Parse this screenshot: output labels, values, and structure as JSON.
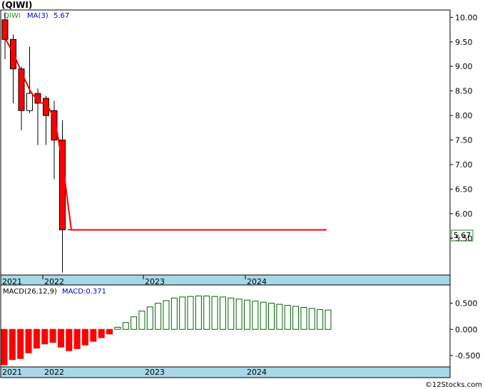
{
  "header": {
    "ticker": "(QIWI)",
    "series_label": "QIWI",
    "ma_label": "MA(3)",
    "ma_value": "5.67"
  },
  "price_badge": "5.67",
  "macd_label": "MACD(26,12,9)",
  "macd_value_label": "MACD:0.371",
  "watermark": "©12Stocks.com",
  "colors": {
    "down": "#ff0000",
    "up": "#ffffff",
    "ma": "#ff0000",
    "macd_pos": "#006400",
    "macd_neg": "#ff0000",
    "axis_band": "#a8d8e8"
  },
  "chart_data": [
    {
      "type": "candlestick",
      "title": "(QIWI)",
      "ma_label": "MA(3)",
      "x_labels": [
        "2021",
        "2022",
        "2023",
        "2024"
      ],
      "y_ticks": [
        5.5,
        6.0,
        6.5,
        7.0,
        7.5,
        8.0,
        8.5,
        9.0,
        9.5,
        10.0
      ],
      "y_tick_labels": [
        "5.50",
        "6.00",
        "6.50",
        "7.00",
        "7.50",
        "8.00",
        "8.50",
        "9.00",
        "9.50",
        "10.00"
      ],
      "ylim": [
        4.75,
        10.15
      ],
      "candles": [
        {
          "open": 9.95,
          "high": 10.1,
          "low": 9.15,
          "close": 9.55
        },
        {
          "open": 9.55,
          "high": 9.65,
          "low": 8.25,
          "close": 8.95
        },
        {
          "open": 8.95,
          "high": 9.0,
          "low": 7.7,
          "close": 8.1
        },
        {
          "open": 8.1,
          "high": 9.4,
          "low": 8.05,
          "close": 8.45
        },
        {
          "open": 8.45,
          "high": 8.55,
          "low": 7.4,
          "close": 8.25
        },
        {
          "open": 8.35,
          "high": 8.4,
          "low": 7.4,
          "close": 8.0
        },
        {
          "open": 8.1,
          "high": 8.3,
          "low": 6.7,
          "close": 7.5
        },
        {
          "open": 7.5,
          "high": 7.9,
          "low": 4.8,
          "close": 5.67
        },
        {
          "open": 5.67,
          "high": 5.67,
          "low": 5.67,
          "close": 5.67
        }
      ],
      "ma": [
        9.55,
        9.25,
        8.85,
        8.5,
        8.27,
        8.23,
        7.92,
        6.95,
        5.67,
        5.67
      ],
      "last_value": 5.67
    },
    {
      "type": "bar",
      "title": "MACD(26,12,9)",
      "value_label": "MACD:0.371",
      "x_labels": [
        "2021",
        "2022",
        "2023",
        "2024"
      ],
      "y_ticks": [
        -0.5,
        0.0,
        0.5
      ],
      "y_tick_labels": [
        "-0.500",
        "0.000",
        "0.500"
      ],
      "ylim": [
        -0.72,
        0.85
      ],
      "values": [
        -0.68,
        -0.58,
        -0.56,
        -0.45,
        -0.36,
        -0.28,
        -0.25,
        -0.34,
        -0.41,
        -0.37,
        -0.3,
        -0.23,
        -0.16,
        -0.09,
        0.04,
        0.13,
        0.24,
        0.35,
        0.43,
        0.5,
        0.55,
        0.6,
        0.62,
        0.63,
        0.64,
        0.64,
        0.63,
        0.62,
        0.6,
        0.58,
        0.56,
        0.54,
        0.52,
        0.5,
        0.48,
        0.46,
        0.44,
        0.42,
        0.4,
        0.38,
        0.37
      ]
    }
  ]
}
